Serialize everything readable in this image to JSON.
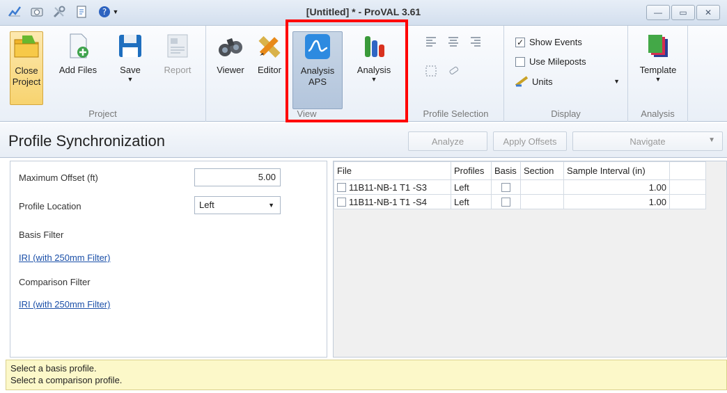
{
  "window": {
    "title": "[Untitled] * - ProVAL 3.61",
    "controls": [
      "minimize",
      "maximize",
      "close"
    ]
  },
  "quick_access": [
    "app-icon",
    "camera-icon",
    "tools-icon",
    "document-icon",
    "help-icon"
  ],
  "ribbon": {
    "groups": {
      "project": "Project",
      "view": "View",
      "profile_selection": "Profile Selection",
      "display": "Display",
      "analysis": "Analysis"
    },
    "buttons": {
      "close_project": "Close Project",
      "add_files": "Add Files",
      "save": "Save",
      "report": "Report",
      "viewer": "Viewer",
      "editor": "Editor",
      "analysis_aps": "Analysis APS",
      "analysis": "Analysis",
      "template": "Template"
    },
    "display": {
      "show_events": "Show Events",
      "show_events_checked": true,
      "use_mileposts": "Use Mileposts",
      "use_mileposts_checked": false,
      "units": "Units"
    }
  },
  "pane": {
    "title": "Profile Synchronization",
    "analyze": "Analyze",
    "apply_offsets": "Apply Offsets",
    "navigate": "Navigate"
  },
  "settings": {
    "max_offset_label": "Maximum Offset (ft)",
    "max_offset_value": "5.00",
    "profile_location_label": "Profile Location",
    "profile_location_value": "Left",
    "basis_filter_label": "Basis Filter",
    "basis_filter_link": "IRI (with 250mm Filter)",
    "comparison_filter_label": "Comparison Filter",
    "comparison_filter_link": "IRI (with 250mm Filter)"
  },
  "grid": {
    "columns": [
      "File",
      "Profiles",
      "Basis",
      "Section",
      "Sample Interval (in)"
    ],
    "rows": [
      {
        "file": "11B11-NB-1 T1 -S3",
        "profiles": "Left",
        "basis": false,
        "section": "",
        "interval": "1.00"
      },
      {
        "file": "11B11-NB-1 T1 -S4",
        "profiles": "Left",
        "basis": false,
        "section": "",
        "interval": "1.00"
      }
    ]
  },
  "status": {
    "line1": "Select a basis profile.",
    "line2": "Select a comparison profile."
  }
}
